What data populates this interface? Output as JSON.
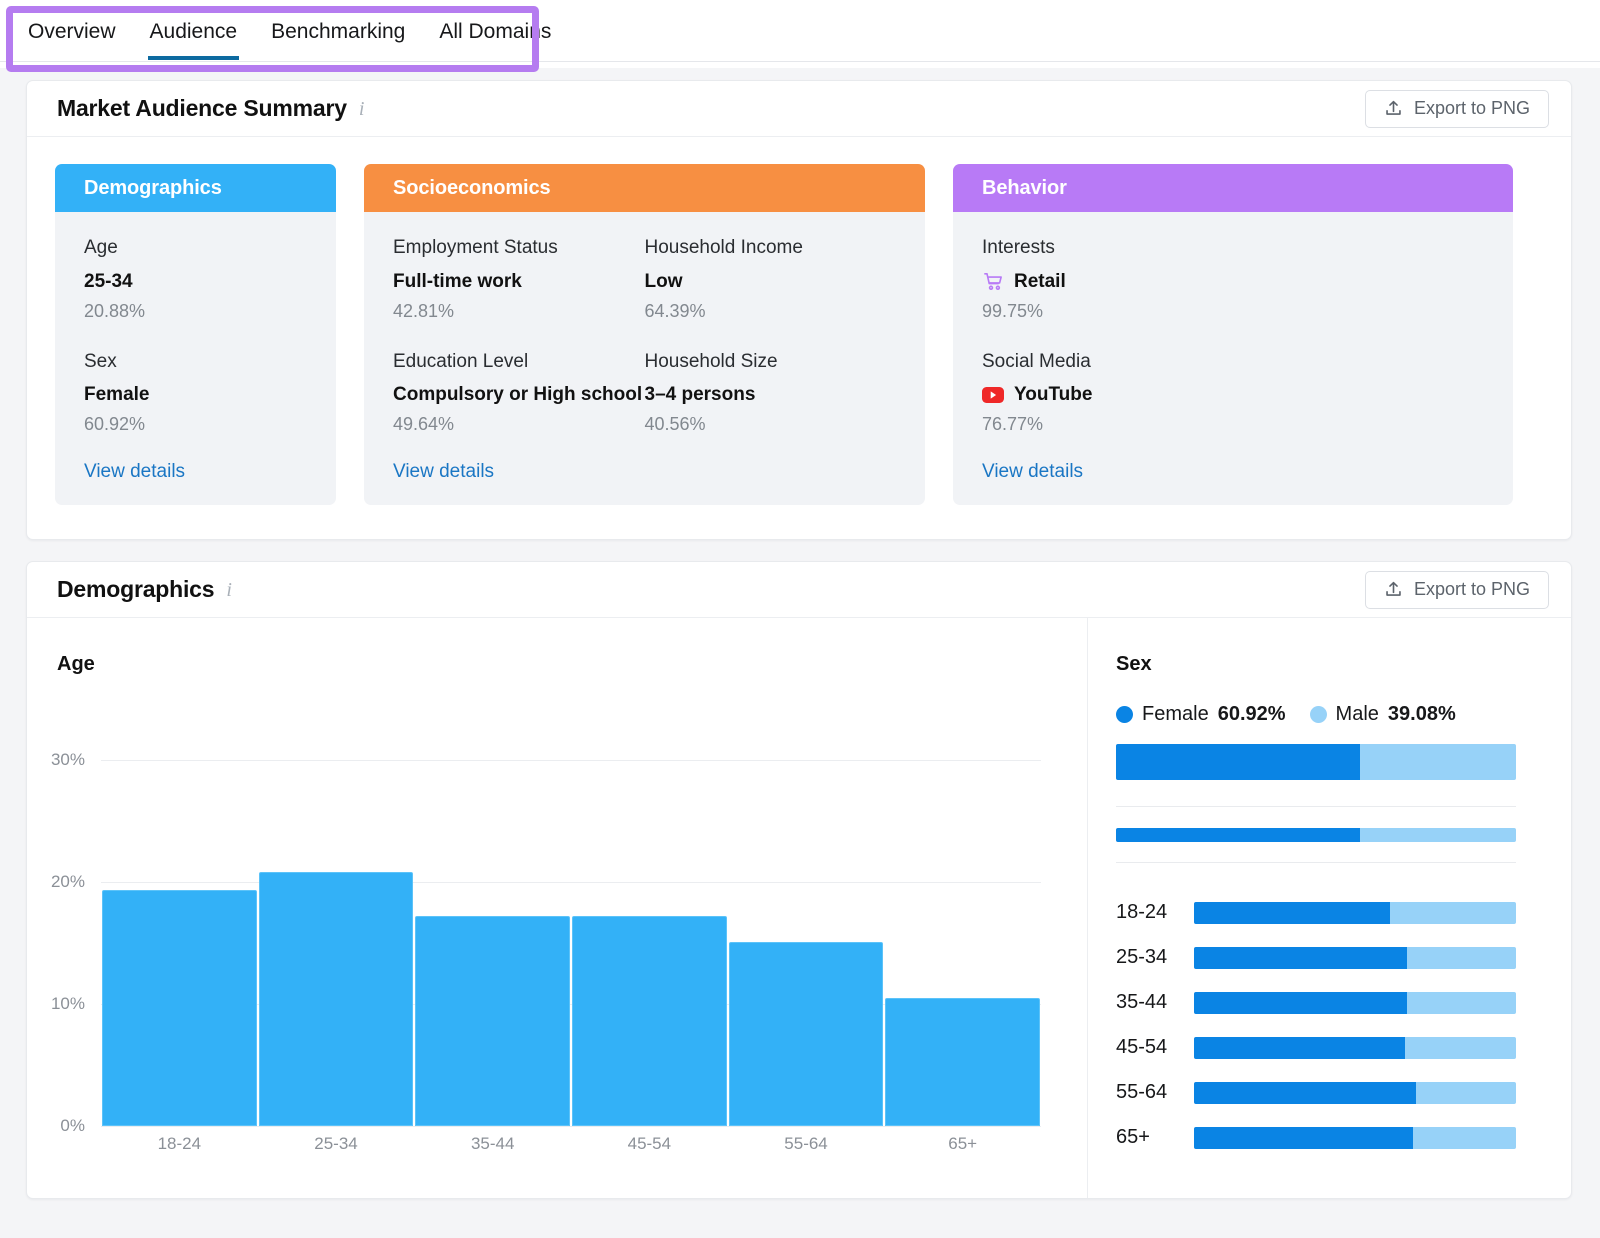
{
  "tabs": [
    {
      "label": "Overview",
      "active": false
    },
    {
      "label": "Audience",
      "active": true
    },
    {
      "label": "Benchmarking",
      "active": false
    },
    {
      "label": "All Domains",
      "active": false
    }
  ],
  "colors": {
    "accent_blue": "#33b1f7",
    "female": "#0a84e4",
    "male": "#97d2f8",
    "demographics_header": "#33b1f7",
    "socioeconomics_header": "#f78f42",
    "behavior_header": "#b87af6",
    "link": "#1a76c4",
    "highlight_outline": "#b57cf0",
    "tab_underline": "#0d6aa0"
  },
  "summary": {
    "title": "Market Audience Summary",
    "info_icon": "info-icon",
    "export_label": "Export to PNG",
    "export_icon": "upload-icon",
    "view_details_label": "View details",
    "cards": [
      {
        "name": "Demographics",
        "fields": [
          {
            "label": "Age",
            "value": "25-34",
            "percent": "20.88%"
          },
          {
            "label": "Sex",
            "value": "Female",
            "percent": "60.92%"
          }
        ]
      },
      {
        "name": "Socioeconomics",
        "fields": [
          {
            "label": "Employment Status",
            "value": "Full-time work",
            "percent": "42.81%"
          },
          {
            "label": "Household Income",
            "value": "Low",
            "percent": "64.39%"
          },
          {
            "label": "Education Level",
            "value": "Compulsory or High school",
            "percent": "49.64%"
          },
          {
            "label": "Household Size",
            "value": "3–4 persons",
            "percent": "40.56%"
          }
        ]
      },
      {
        "name": "Behavior",
        "fields": [
          {
            "label": "Interests",
            "value": "Retail",
            "percent": "99.75%",
            "icon": "shopping-cart-icon"
          },
          {
            "label": "Social Media",
            "value": "YouTube",
            "percent": "76.77%",
            "icon": "youtube-icon"
          }
        ]
      }
    ]
  },
  "demographics": {
    "title": "Demographics",
    "info_icon": "info-icon",
    "export_label": "Export to PNG",
    "export_icon": "upload-icon",
    "age_panel_title": "Age",
    "sex_panel_title": "Sex",
    "legend": [
      {
        "label": "Female",
        "value": "60.92%",
        "color": "#0a84e4"
      },
      {
        "label": "Male",
        "value": "39.08%",
        "color": "#97d2f8"
      }
    ]
  },
  "chart_data": [
    {
      "type": "bar",
      "title": "Age",
      "categories": [
        "18-24",
        "25-34",
        "35-44",
        "45-54",
        "55-64",
        "65+"
      ],
      "values": [
        19.4,
        20.88,
        17.2,
        17.2,
        15.1,
        10.5
      ],
      "xlabel": "",
      "ylabel": "",
      "ylim": [
        0,
        32
      ],
      "yticks": [
        0,
        10,
        20,
        30
      ],
      "ytick_labels": [
        "0%",
        "10%",
        "20%",
        "30%"
      ],
      "grid": true,
      "legend": "none",
      "series_color": "#33b1f7"
    },
    {
      "type": "bar",
      "title": "Sex",
      "orientation": "horizontal",
      "stacked": true,
      "overall": {
        "Female": 60.92,
        "Male": 39.08
      },
      "categories": [
        "18-24",
        "25-34",
        "35-44",
        "45-54",
        "55-64",
        "65+"
      ],
      "series": [
        {
          "name": "Female",
          "color": "#0a84e4",
          "values": [
            61.0,
            66.0,
            66.0,
            65.5,
            69.0,
            68.0
          ]
        },
        {
          "name": "Male",
          "color": "#97d2f8",
          "values": [
            39.0,
            34.0,
            34.0,
            34.5,
            31.0,
            32.0
          ]
        }
      ],
      "xlabel": "",
      "ylabel": "",
      "grid": false,
      "legend": "top"
    }
  ]
}
